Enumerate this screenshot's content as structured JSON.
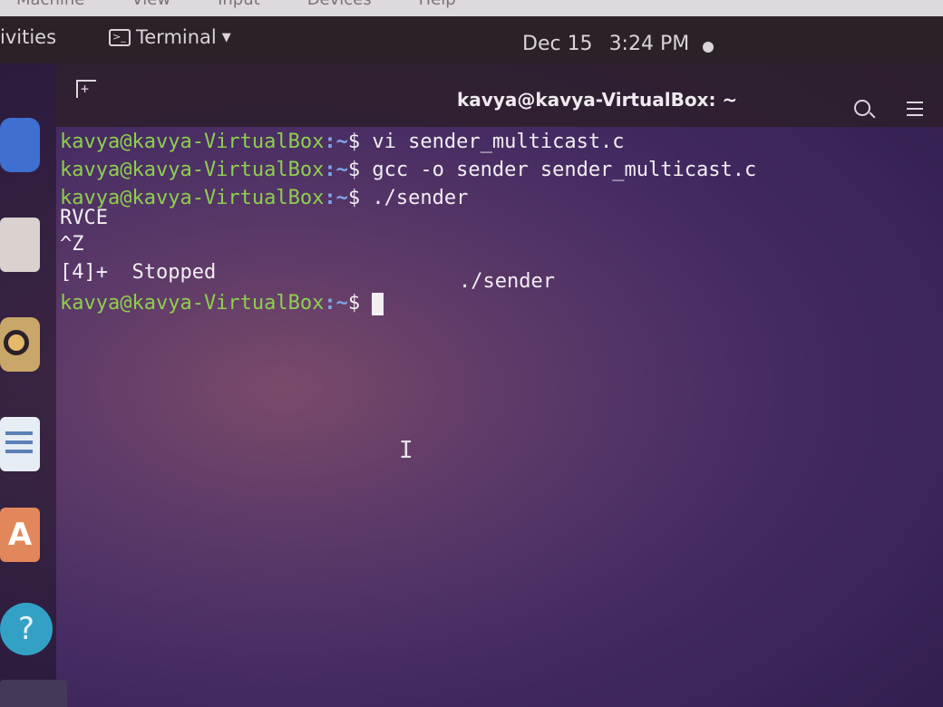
{
  "vbox_menu": {
    "items": [
      "Machine",
      "View",
      "Input",
      "Devices",
      "Help"
    ]
  },
  "topbar": {
    "activities": "ivities",
    "app_menu_label": "Terminal",
    "date": "Dec 15",
    "time": "3:24 PM"
  },
  "terminal": {
    "title": "kavya@kavya-VirtualBox: ~",
    "prompt_user": "kavya@kavya-VirtualBox",
    "prompt_path": ":~",
    "prompt_symbol": "$",
    "lines": [
      {
        "command": " vi sender_multicast.c"
      },
      {
        "command": " gcc -o sender sender_multicast.c"
      },
      {
        "command": " ./sender"
      }
    ],
    "output": [
      "RVCE",
      "^Z",
      "[4]+  Stopped"
    ],
    "stopped_job": "./sender"
  },
  "icons": {
    "app_menu": "terminal-icon",
    "new_tab": "new-tab-icon",
    "search": "search-icon",
    "menu": "hamburger-menu-icon",
    "status_dot": "status-dot-icon",
    "text_cursor": "ibeam-cursor-icon"
  }
}
